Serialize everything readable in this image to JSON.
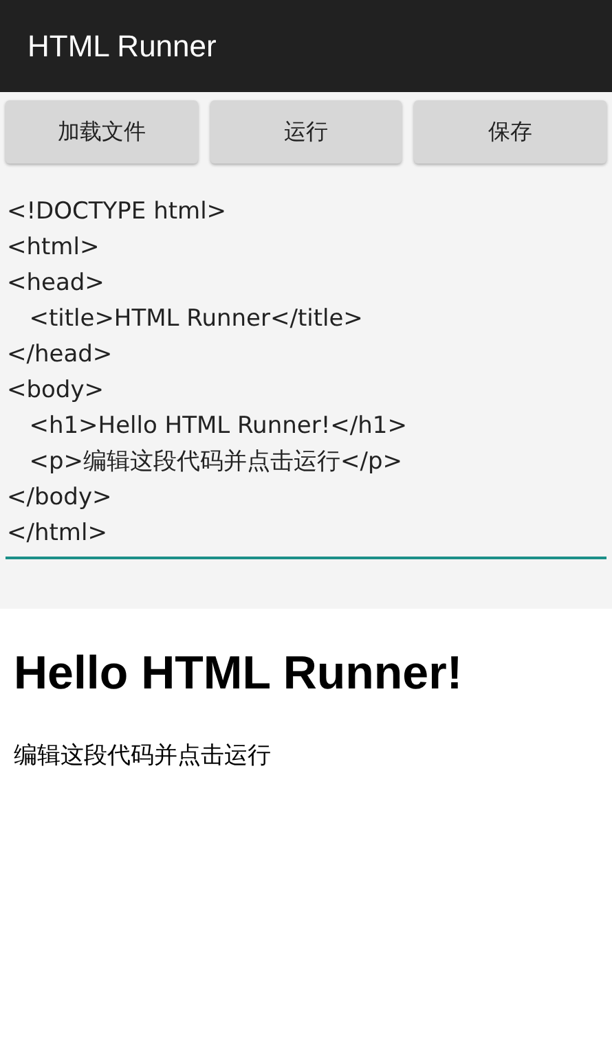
{
  "app_bar": {
    "title": "HTML Runner"
  },
  "buttons": [
    "加载文件",
    "运行",
    "保存"
  ],
  "editor": {
    "value": "<!DOCTYPE html>\n<html>\n<head>\n   <title>HTML Runner</title>\n</head>\n<body>\n   <h1>Hello HTML Runner!</h1>\n   <p>编辑这段代码并点击运行</p>\n</body>\n</html>"
  },
  "preview": {
    "heading": "Hello HTML Runner!",
    "paragraph": "编辑这段代码并点击运行"
  }
}
